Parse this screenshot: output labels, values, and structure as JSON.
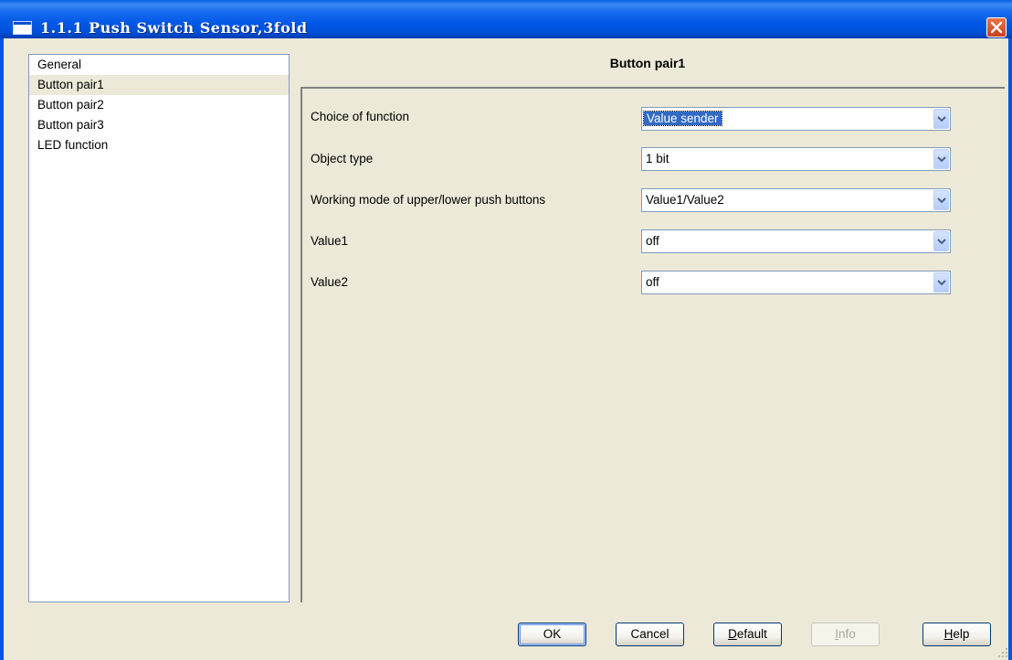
{
  "window": {
    "title": "1.1.1 Push Switch Sensor,3fold"
  },
  "tree": {
    "items": [
      "General",
      "Button pair1",
      "Button pair2",
      "Button pair3",
      "LED function"
    ],
    "selected_index": 1
  },
  "panel": {
    "title": "Button pair1",
    "params": [
      {
        "label": "Choice of function",
        "value": "Value sender"
      },
      {
        "label": "Object type",
        "value": "1 bit"
      },
      {
        "label": "Working mode of upper/lower push buttons",
        "value": "Value1/Value2"
      },
      {
        "label": "Value1",
        "value": "off"
      },
      {
        "label": "Value2",
        "value": "off"
      }
    ]
  },
  "buttons": {
    "ok": "OK",
    "cancel": "Cancel",
    "default_first": "D",
    "default_rest": "efault",
    "info_first": "I",
    "info_rest": "nfo",
    "help_first": "H",
    "help_rest": "elp"
  },
  "colors": {
    "titlebar": "#0058e6",
    "dialog_bg": "#ece9d8",
    "selection": "#316ac5"
  }
}
